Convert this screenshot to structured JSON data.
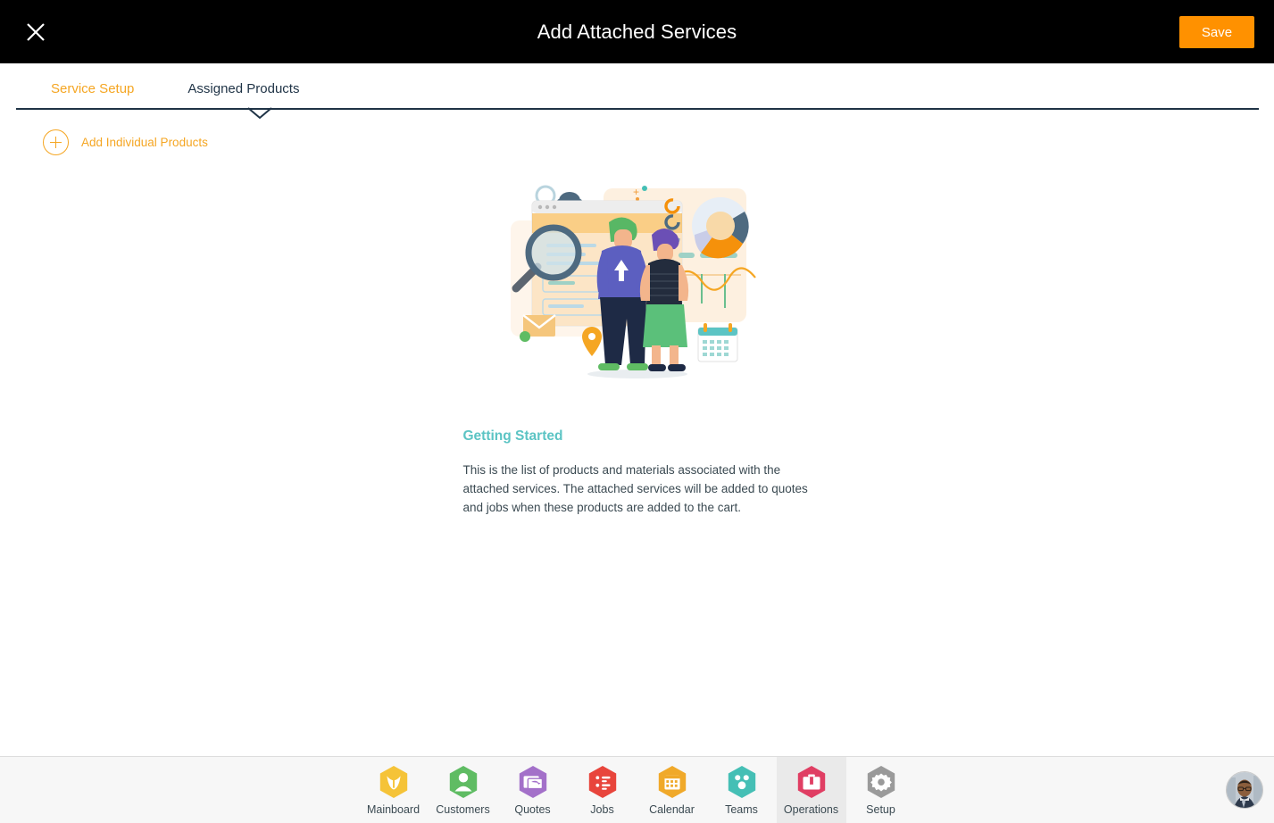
{
  "header": {
    "title": "Add Attached Services",
    "close_icon": "close-icon",
    "save_label": "Save",
    "save_color": "#FF9100"
  },
  "tabs": {
    "items": [
      {
        "label": "Service Setup",
        "active": false,
        "color": "#F5A623"
      },
      {
        "label": "Assigned Products",
        "active": true,
        "color": "#1F3346"
      }
    ],
    "rule_color": "#1F3346",
    "chevron_icon": "chevron-down-icon"
  },
  "toolbar": {
    "add_products_label": "Add Individual Products",
    "add_icon": "plus-circle-icon",
    "accent_color": "#F5A623"
  },
  "empty_state": {
    "illustration": "team-analytics-illustration",
    "title": "Getting Started",
    "title_color": "#5CC4C4",
    "body": "This is the list of products and materials associated with the attached services. The attached services will be added to quotes and jobs when these products are added to the cart."
  },
  "bottom_nav": {
    "items": [
      {
        "label": "Mainboard",
        "icon": "mainboard-icon",
        "color": "#F5C338",
        "active": false
      },
      {
        "label": "Customers",
        "icon": "customers-icon",
        "color": "#5FBC63",
        "active": false
      },
      {
        "label": "Quotes",
        "icon": "quotes-icon",
        "color": "#A370C9",
        "active": false
      },
      {
        "label": "Jobs",
        "icon": "jobs-icon",
        "color": "#E8453C",
        "active": false
      },
      {
        "label": "Calendar",
        "icon": "calendar-icon",
        "color": "#F0A92A",
        "active": false
      },
      {
        "label": "Teams",
        "icon": "teams-icon",
        "color": "#45BFB5",
        "active": false
      },
      {
        "label": "Operations",
        "icon": "operations-icon",
        "color": "#E03E63",
        "active": true
      },
      {
        "label": "Setup",
        "icon": "setup-gear-icon",
        "color": "#9A9A9A",
        "active": false
      }
    ],
    "avatar": "user-avatar"
  }
}
